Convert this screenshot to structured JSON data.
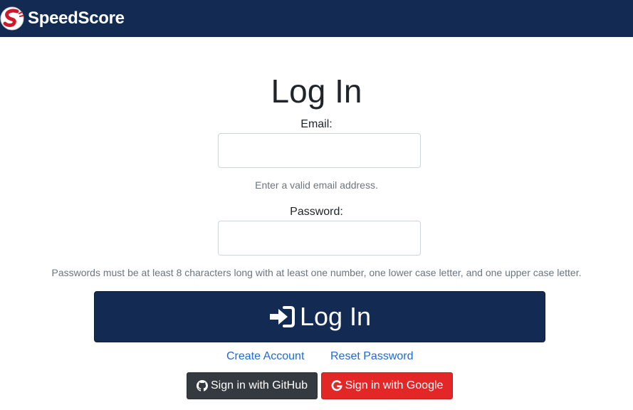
{
  "navbar": {
    "brand_name": "SpeedScore",
    "logo_icon": "speedscore-logo-icon"
  },
  "login": {
    "title": "Log In",
    "email_label": "Email:",
    "email_value": "",
    "email_help": "Enter a valid email address.",
    "password_label": "Password:",
    "password_value": "",
    "password_help": "Passwords must be at least 8 characters long with at least one number, one lower case letter, and one upper case letter.",
    "submit_label": "Log In",
    "submit_icon": "sign-in-icon",
    "create_account_label": "Create Account",
    "reset_password_label": "Reset Password",
    "github_label": "Sign in with GitHub",
    "github_icon": "github-icon",
    "google_label": "Sign in with Google",
    "google_icon": "google-icon"
  },
  "colors": {
    "navbar": "#132a53",
    "primary_button": "#132a53",
    "link": "#1f6ad8",
    "github_button": "#343a40",
    "google_button": "#e32626"
  }
}
